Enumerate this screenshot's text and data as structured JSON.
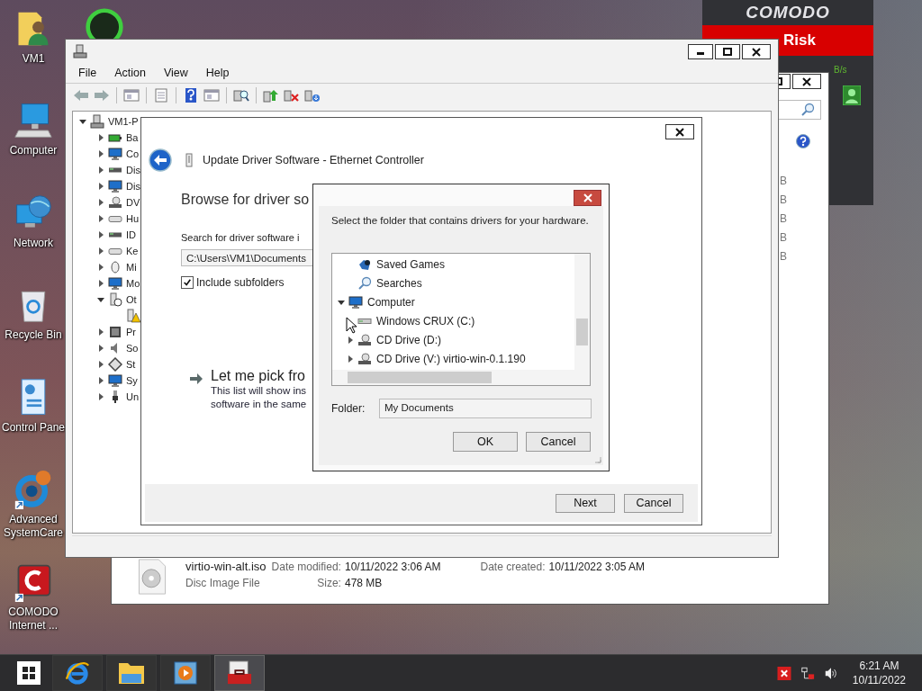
{
  "desktop": {
    "icons": [
      {
        "kind": "user-folder",
        "label": "VM1"
      },
      {
        "kind": "computer",
        "label": "Computer"
      },
      {
        "kind": "network",
        "label": "Network"
      },
      {
        "kind": "recycle-bin",
        "label": "Recycle Bin"
      },
      {
        "kind": "control-panel",
        "label": "Control Pane"
      },
      {
        "kind": "systemcare",
        "label": "Advanced SystemCare"
      },
      {
        "kind": "comodo",
        "label": "COMODO Internet ..."
      }
    ]
  },
  "comodo_widget": {
    "title": "COMODO",
    "status": "Risk",
    "speed": "B/s"
  },
  "explorer": {
    "size_column": [
      "B",
      "B",
      "B",
      "B",
      "B"
    ],
    "file": {
      "name": "virtio-win-alt.iso",
      "type": "Disc Image File",
      "fields": [
        {
          "label": "Date modified:",
          "value": "10/11/2022 3:06 AM"
        },
        {
          "label": "Date created:",
          "value": "10/11/2022 3:05 AM"
        },
        {
          "label": "Size:",
          "value": "478 MB"
        }
      ]
    }
  },
  "device_manager": {
    "menu": [
      "File",
      "Action",
      "View",
      "Help"
    ],
    "toolbar": [
      [
        {
          "kind": "back"
        },
        {
          "kind": "forward"
        }
      ],
      [
        {
          "kind": "pane"
        }
      ],
      [
        {
          "kind": "sheet"
        }
      ],
      [
        {
          "kind": "help"
        },
        {
          "kind": "pane"
        }
      ],
      [
        {
          "kind": "scan"
        }
      ],
      [
        {
          "kind": "upload"
        },
        {
          "kind": "remove"
        },
        {
          "kind": "download"
        }
      ]
    ],
    "tree": {
      "kind": "pc",
      "label": "VM1-P",
      "expanded": true,
      "children": [
        {
          "kind": "battery",
          "label": "Ba",
          "expanded": false
        },
        {
          "kind": "monitor",
          "label": "Co",
          "expanded": false
        },
        {
          "kind": "drive",
          "label": "Dis",
          "expanded": false
        },
        {
          "kind": "monitor",
          "label": "Dis",
          "expanded": false
        },
        {
          "kind": "disc",
          "label": "DV",
          "expanded": false
        },
        {
          "kind": "keyboard",
          "label": "Hu",
          "expanded": false
        },
        {
          "kind": "drive",
          "label": "ID",
          "expanded": false
        },
        {
          "kind": "keyboard",
          "label": "Ke",
          "expanded": false
        },
        {
          "kind": "mouse",
          "label": "Mi",
          "expanded": false
        },
        {
          "kind": "monitor",
          "label": "Mo",
          "expanded": false
        },
        {
          "kind": "device",
          "label": "Ot",
          "expanded": true,
          "children": [
            {
              "kind": "warning-device"
            }
          ]
        },
        {
          "kind": "chip",
          "label": "Pr",
          "expanded": false
        },
        {
          "kind": "speaker",
          "label": "So",
          "expanded": false
        },
        {
          "kind": "diamond",
          "label": "St",
          "expanded": false
        },
        {
          "kind": "monitor",
          "label": "Sy",
          "expanded": false
        },
        {
          "kind": "plug",
          "label": "Un",
          "expanded": false
        }
      ]
    }
  },
  "update_driver": {
    "title": "Update Driver Software - Ethernet Controller",
    "heading": "Browse for driver so",
    "search_label": "Search for driver software i",
    "path": "C:\\Users\\VM1\\Documents",
    "include_subfolders": {
      "label": "Include subfolders",
      "checked": true
    },
    "pick": {
      "title": "Let me pick fro",
      "description": "This list will show ins\nsoftware in the same"
    },
    "buttons": [
      "Next",
      "Cancel"
    ]
  },
  "browse_dialog": {
    "prompt": "Select the folder that contains drivers for your hardware.",
    "tree": [
      {
        "children": [
          {
            "kind": "saved-games",
            "label": "Saved Games"
          },
          {
            "kind": "search",
            "label": "Searches"
          }
        ]
      },
      {
        "kind": "monitor",
        "label": "Computer",
        "expanded": true,
        "children": [
          {
            "kind": "hard-drive",
            "label": "Windows CRUX (C:)"
          },
          {
            "kind": "cd-drive",
            "label": "CD Drive (D:)",
            "expanded": false
          },
          {
            "kind": "cd-drive",
            "label": "CD Drive (V:) virtio-win-0.1.190",
            "expanded": false
          }
        ]
      }
    ],
    "folder_label": "Folder:",
    "folder": "My Documents",
    "buttons": [
      "OK",
      "Cancel"
    ]
  },
  "taskbar": {
    "apps": [
      {
        "kind": "browser",
        "selected": false
      },
      {
        "kind": "folder",
        "selected": false
      },
      {
        "kind": "media",
        "selected": false
      },
      {
        "kind": "toolbox",
        "selected": true
      }
    ],
    "tray": [
      {
        "kind": "x-badge"
      },
      {
        "kind": "network"
      },
      {
        "kind": "volume"
      }
    ],
    "time": "6:21 AM",
    "date": "10/11/2022"
  }
}
